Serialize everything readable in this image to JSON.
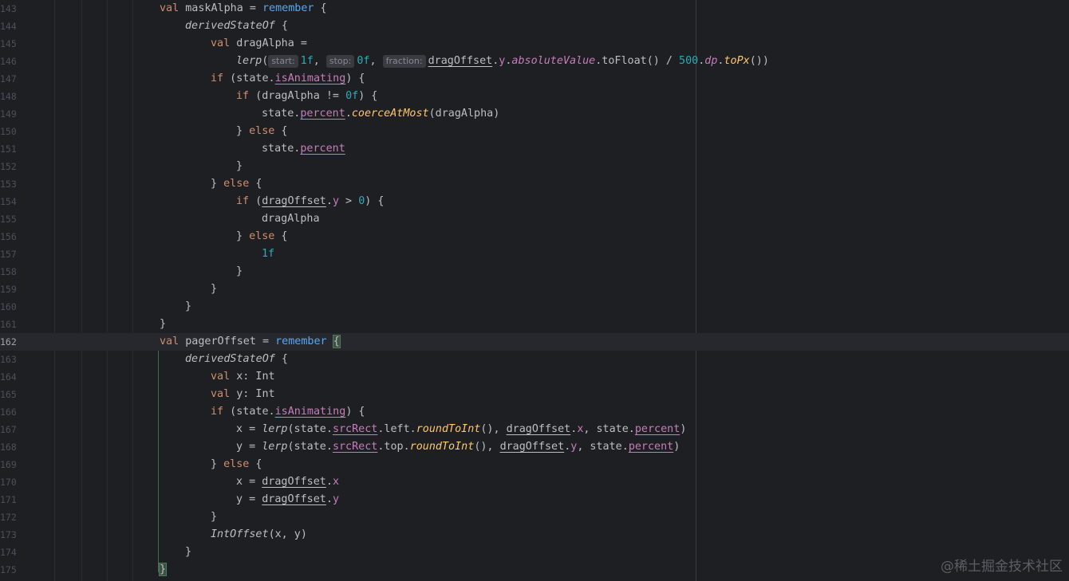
{
  "editor": {
    "watermark": "@稀土掘金技术社区",
    "current_line": "162",
    "lines": [
      {
        "n": "143",
        "code": "val maskAlpha = remember {"
      },
      {
        "n": "144",
        "code": "derivedStateOf {"
      },
      {
        "n": "145",
        "code": "val dragAlpha ="
      },
      {
        "n": "146",
        "code": "lerp( start: 1f,  stop: 0f,  fraction: dragOffset.y.absoluteValue.toFloat() / 500.dp.toPx())"
      },
      {
        "n": "147",
        "code": "if (state.isAnimating) {"
      },
      {
        "n": "148",
        "code": "if (dragAlpha != 0f) {"
      },
      {
        "n": "149",
        "code": "state.percent.coerceAtMost(dragAlpha)"
      },
      {
        "n": "150",
        "code": "} else {"
      },
      {
        "n": "151",
        "code": "state.percent"
      },
      {
        "n": "152",
        "code": "}"
      },
      {
        "n": "153",
        "code": "} else {"
      },
      {
        "n": "154",
        "code": "if (dragOffset.y > 0) {"
      },
      {
        "n": "155",
        "code": "dragAlpha"
      },
      {
        "n": "156",
        "code": "} else {"
      },
      {
        "n": "157",
        "code": "1f"
      },
      {
        "n": "158",
        "code": "}"
      },
      {
        "n": "159",
        "code": "}"
      },
      {
        "n": "160",
        "code": "}"
      },
      {
        "n": "161",
        "code": "}"
      },
      {
        "n": "162",
        "code": "val pagerOffset = remember {"
      },
      {
        "n": "163",
        "code": "derivedStateOf {"
      },
      {
        "n": "164",
        "code": "val x: Int"
      },
      {
        "n": "165",
        "code": "val y: Int"
      },
      {
        "n": "166",
        "code": "if (state.isAnimating) {"
      },
      {
        "n": "167",
        "code": "x = lerp(state.srcRect.left.roundToInt(), dragOffset.x, state.percent)"
      },
      {
        "n": "168",
        "code": "y = lerp(state.srcRect.top.roundToInt(), dragOffset.y, state.percent)"
      },
      {
        "n": "169",
        "code": "} else {"
      },
      {
        "n": "170",
        "code": "x = dragOffset.x"
      },
      {
        "n": "171",
        "code": "y = dragOffset.y"
      },
      {
        "n": "172",
        "code": "}"
      },
      {
        "n": "173",
        "code": "IntOffset(x, y)"
      },
      {
        "n": "174",
        "code": "}"
      },
      {
        "n": "175",
        "code": "}"
      }
    ],
    "param_hints": [
      "start:",
      "stop:",
      "fraction:"
    ]
  }
}
